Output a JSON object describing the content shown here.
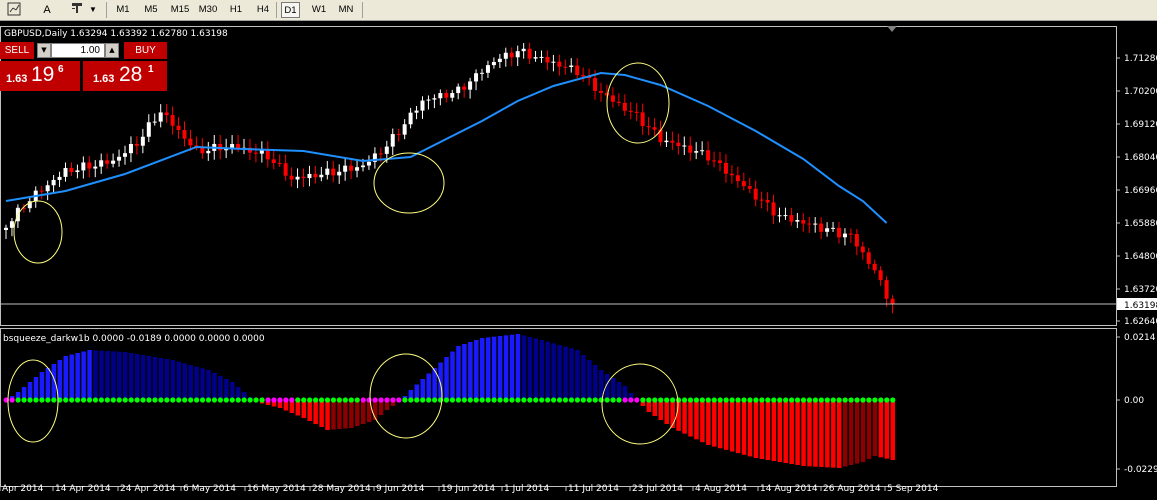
{
  "toolbar": {
    "icons": [
      "chart-icon",
      "text-icon",
      "label-icon",
      "objects-dropdown-icon"
    ],
    "text_tool": "A",
    "timeframes": [
      "M1",
      "M5",
      "M15",
      "M30",
      "H1",
      "H4",
      "D1",
      "W1",
      "MN"
    ],
    "active_timeframe": "D1"
  },
  "chart": {
    "header": "GBPUSD,Daily  1.63294 1.63392 1.62780 1.63198",
    "price_ticks": [
      "1.71280",
      "1.70200",
      "1.69120",
      "1.68040",
      "1.66960",
      "1.65880",
      "1.64800",
      "1.63720",
      "1.62640"
    ],
    "current_price": "1.63198",
    "colors": {
      "bull": "#ffffff",
      "bear": "#ff0000",
      "ma": "#1e90ff",
      "annotation": "#ffff80"
    }
  },
  "trade_panel": {
    "sell_label": "SELL",
    "buy_label": "BUY",
    "lot": "1.00",
    "sell_price_small": "1.63",
    "sell_price_big": "19",
    "sell_price_sup": "6",
    "buy_price_small": "1.63",
    "buy_price_big": "28",
    "buy_price_sup": "1"
  },
  "indicator": {
    "header": "bsqueeze_darkw1b 0.0000 -0.0189 0.0000 0.0000 0.0000",
    "ticks": [
      "0.0214",
      "0.00",
      "-0.0229"
    ],
    "colors": {
      "pos": "#1a1aff",
      "pos_dark": "#00008b",
      "neg": "#ff0000",
      "neg_dark": "#8b0000",
      "on": "#00ff00",
      "off": "#ff00ff"
    }
  },
  "time_axis": [
    "Apr 2014",
    "14 Apr 2014",
    "24 Apr 2014",
    "6 May 2014",
    "16 May 2014",
    "28 May 2014",
    "9 Jun 2014",
    "19 Jun 2014",
    "1 Jul 2014",
    "11 Jul 2014",
    "23 Jul 2014",
    "4 Aug 2014",
    "14 Aug 2014",
    "26 Aug 2014",
    "5 Sep 2014"
  ]
}
